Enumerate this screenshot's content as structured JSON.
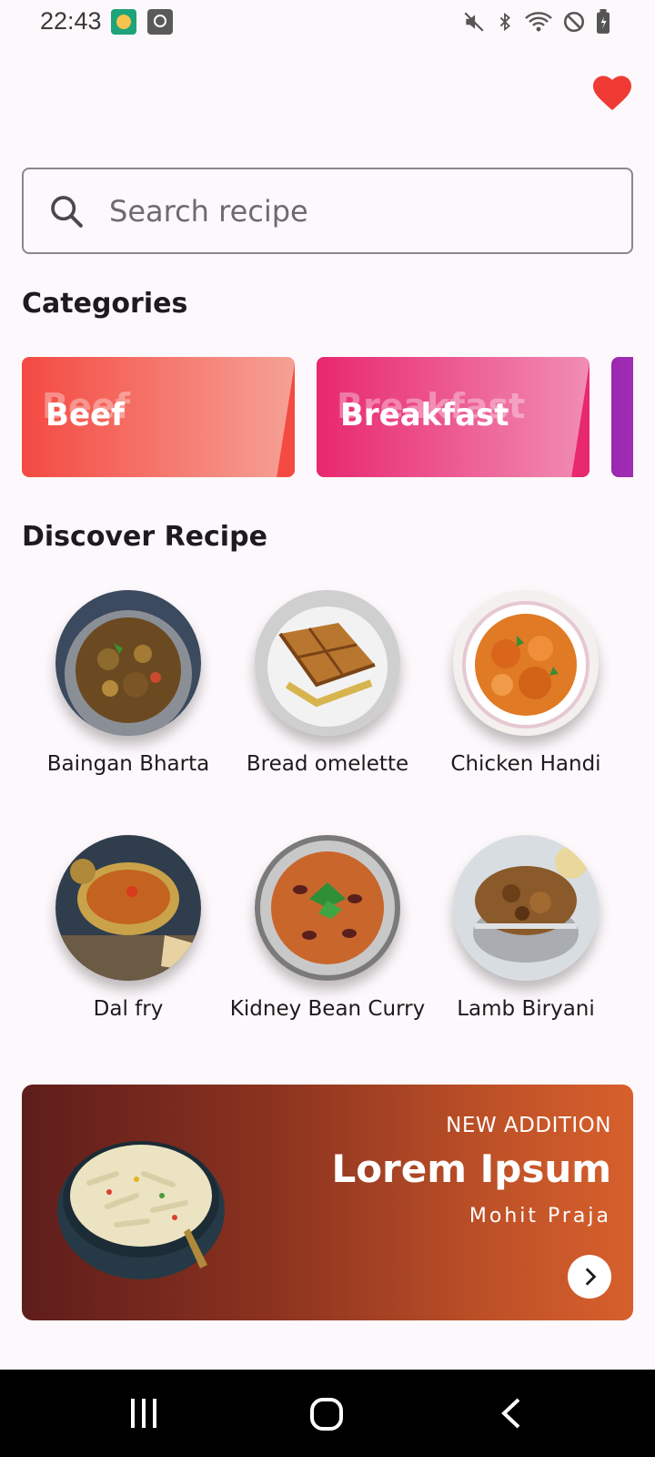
{
  "status_bar": {
    "time": "22:43",
    "icons": [
      "app-notification-icon",
      "clock-app-icon",
      "mute-icon",
      "bluetooth-icon",
      "wifi-icon",
      "do-not-disturb-icon",
      "battery-icon"
    ]
  },
  "header": {
    "favorite_icon": "heart-icon",
    "favorite_color": "#ef3b34"
  },
  "search": {
    "placeholder": "Search recipe",
    "value": ""
  },
  "categories": {
    "title": "Categories",
    "items": [
      {
        "label": "Beef",
        "color_start": "#f44a42",
        "color_end": "#f6a196"
      },
      {
        "label": "Breakfast",
        "color_start": "#e8286f",
        "color_end": "#f18db5"
      },
      {
        "label": "",
        "color_start": "#9c27b0",
        "color_end": "#c77dd6"
      }
    ]
  },
  "discover": {
    "title": "Discover Recipe",
    "recipes": [
      {
        "name": "Baingan Bharta"
      },
      {
        "name": "Bread omelette"
      },
      {
        "name": "Chicken Handi"
      },
      {
        "name": "Dal fry"
      },
      {
        "name": "Kidney Bean Curry"
      },
      {
        "name": "Lamb Biryani"
      }
    ]
  },
  "banner": {
    "eyebrow": "NEW ADDITION",
    "title": "Lorem Ipsum",
    "author": "Mohit Praja",
    "arrow_icon": "chevron-right-icon"
  },
  "nav_bar": {
    "icons": [
      "recent-apps-icon",
      "home-icon",
      "back-icon"
    ]
  }
}
